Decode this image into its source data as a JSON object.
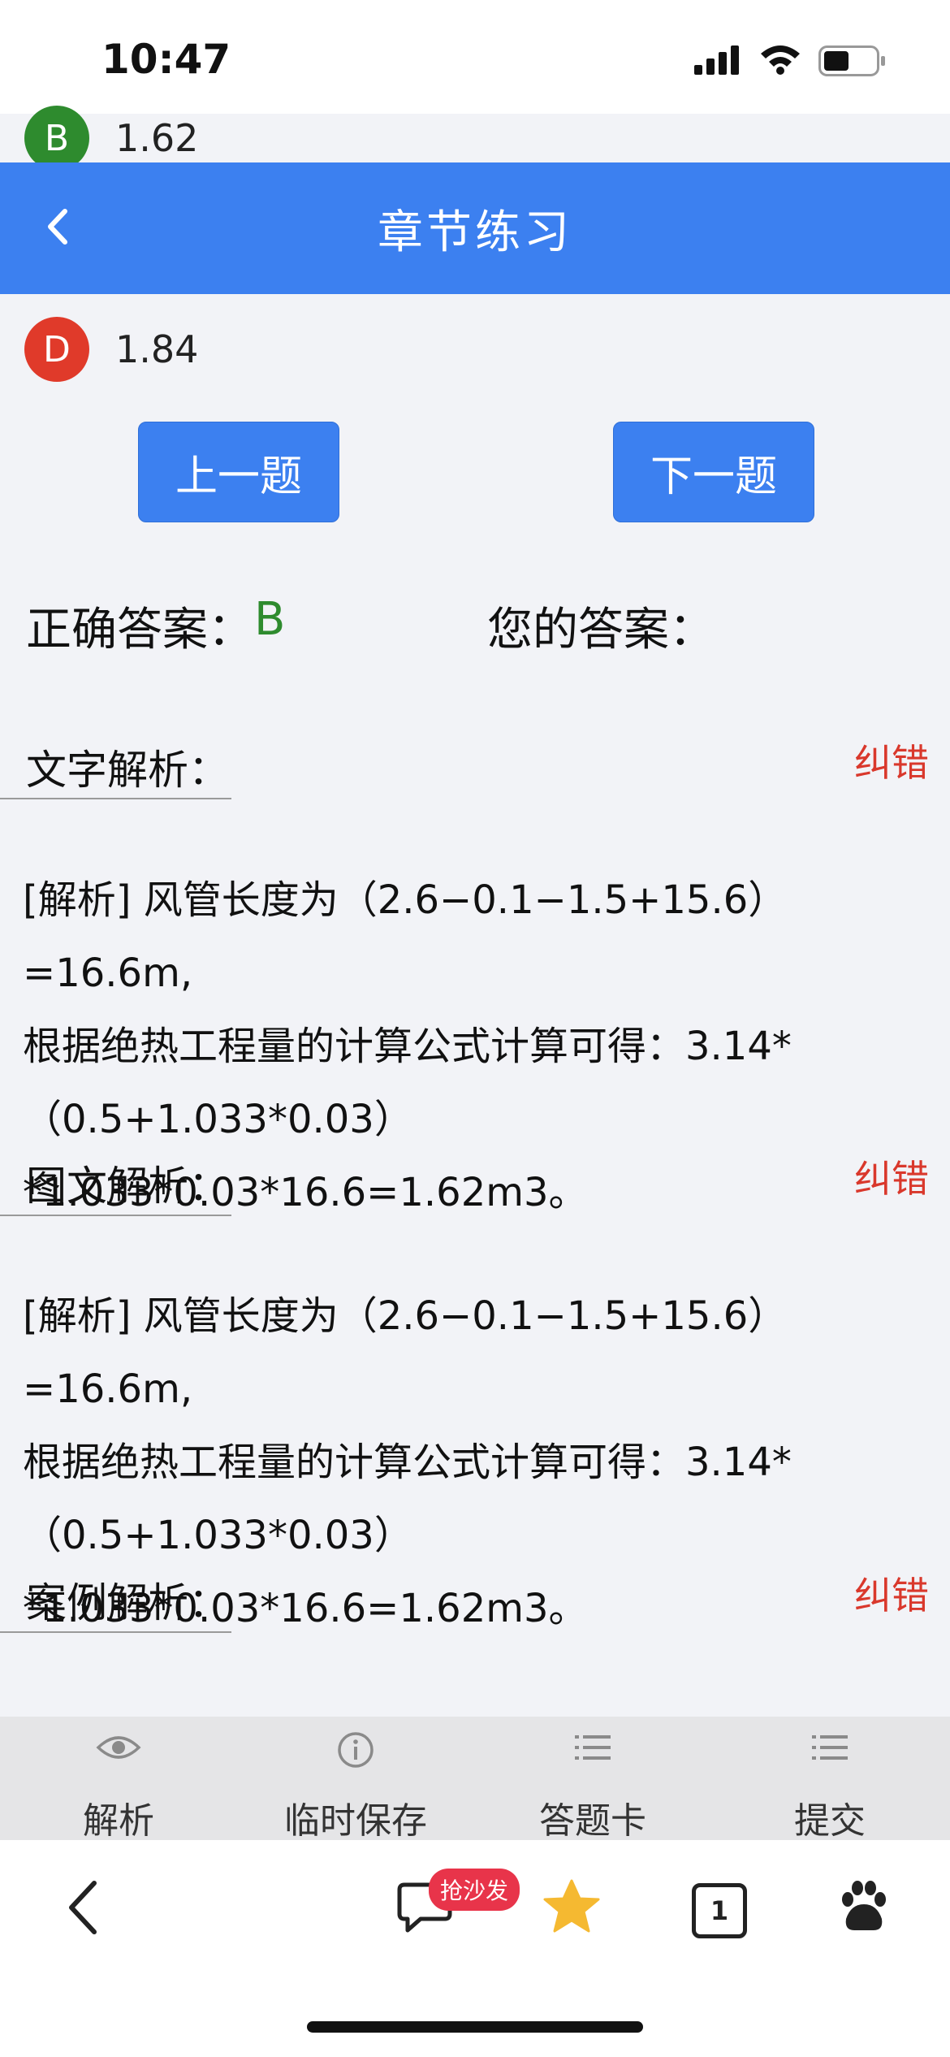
{
  "status_bar": {
    "time": "10:47"
  },
  "options": [
    {
      "letter": "B",
      "value": "1.62",
      "color": "#2e8b2e"
    },
    {
      "letter": "D",
      "value": "1.84",
      "color": "#e03a2a"
    }
  ],
  "nav": {
    "title": "章节练习"
  },
  "buttons": {
    "prev": "上一题",
    "next": "下一题"
  },
  "answer": {
    "correct_label": "正确答案：",
    "correct_value": "B",
    "yours_label": "您的答案："
  },
  "sections": [
    {
      "label": "文字解析：",
      "report": "纠错",
      "lines": [
        "[解析] 风管长度为（2.6−0.1−1.5+15.6）=16.6m,",
        "根据绝热工程量的计算公式计算可得：3.14*",
        "（0.5+1.033*0.03）*1.033*0.03*16.6=1.62m3。"
      ]
    },
    {
      "label": "图文解析：",
      "report": "纠错",
      "lines": [
        "[解析] 风管长度为（2.6−0.1−1.5+15.6）=16.6m,",
        "根据绝热工程量的计算公式计算可得：3.14*",
        "（0.5+1.033*0.03）*1.033*0.03*16.6=1.62m3。"
      ]
    },
    {
      "label": "案例解析：",
      "report": "纠错"
    }
  ],
  "toolbar": [
    {
      "label": "解析",
      "icon": "eye-icon"
    },
    {
      "label": "临时保存",
      "icon": "info-icon"
    },
    {
      "label": "答题卡",
      "icon": "list-icon"
    },
    {
      "label": "提交",
      "icon": "list-icon"
    }
  ],
  "browser": {
    "comment_badge": "抢沙发",
    "tab_count": "1",
    "icons": [
      "back-arrow-icon",
      "comment-icon",
      "star-icon",
      "tabs-icon",
      "baidu-paw-icon"
    ]
  }
}
